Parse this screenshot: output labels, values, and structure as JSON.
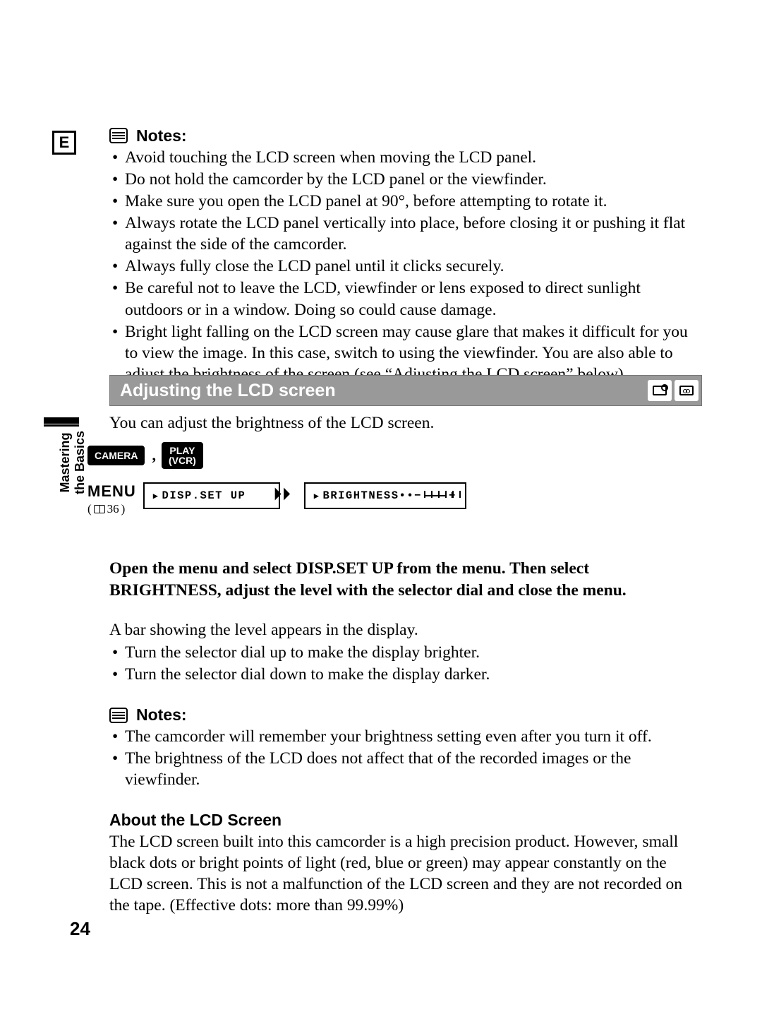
{
  "page": {
    "badge": "E",
    "number": "24"
  },
  "sidebar": {
    "label1": "Mastering",
    "label2": "the Basics"
  },
  "notes1": {
    "label": "Notes:",
    "items": [
      "Avoid touching the LCD screen when moving the LCD panel.",
      "Do not hold the camcorder by the LCD panel or the viewfinder.",
      "Make sure you open the LCD panel at 90°, before attempting to rotate it.",
      "Always rotate the LCD panel vertically into place, before closing it or pushing it flat against the side of the camcorder.",
      "Always fully close the LCD panel until it clicks securely.",
      "Be careful not to leave the LCD, viewfinder or lens exposed to direct sunlight outdoors or in a window. Doing so could cause damage.",
      "Bright light falling on the LCD screen may cause glare that makes it difficult for you to view the image. In this case, switch to using the viewfinder. You are also able to adjust the brightness of the screen (see “Adjusting the LCD screen” below)."
    ]
  },
  "heading": {
    "title": "Adjusting the LCD screen"
  },
  "intro": "You can adjust the brightness of the LCD screen.",
  "modes": {
    "camera": "CAMERA",
    "play_line1": "PLAY",
    "play_line2": "(VCR)"
  },
  "menu": {
    "word": "MENU",
    "page_ref": "36",
    "box1": "DISP.SET UP",
    "box2_label": "BRIGHTNESS",
    "box2_dots": "••",
    "box2_minus": "−",
    "box2_plus": "+"
  },
  "instructions": {
    "bold": "Open the menu and select DISP.SET UP from the menu. Then select BRIGHTNESS, adjust the level with the selector dial and close the menu.",
    "body": "A bar showing the level appears in the display.",
    "bullets": [
      "Turn the selector dial up to make the display brighter.",
      "Turn the selector dial down to make the display darker."
    ]
  },
  "notes2": {
    "label": "Notes:",
    "items": [
      "The camcorder will remember your brightness setting even after you turn it off.",
      "The brightness of the LCD does not affect that of the recorded images or the viewfinder."
    ]
  },
  "about": {
    "heading": "About the LCD Screen",
    "body": "The LCD screen built into this camcorder is a high precision product. However, small black dots or bright points of light (red, blue or green) may appear constantly on the LCD screen. This is not a malfunction of the LCD screen and they are not recorded on the tape. (Effective dots: more than 99.99%)"
  }
}
